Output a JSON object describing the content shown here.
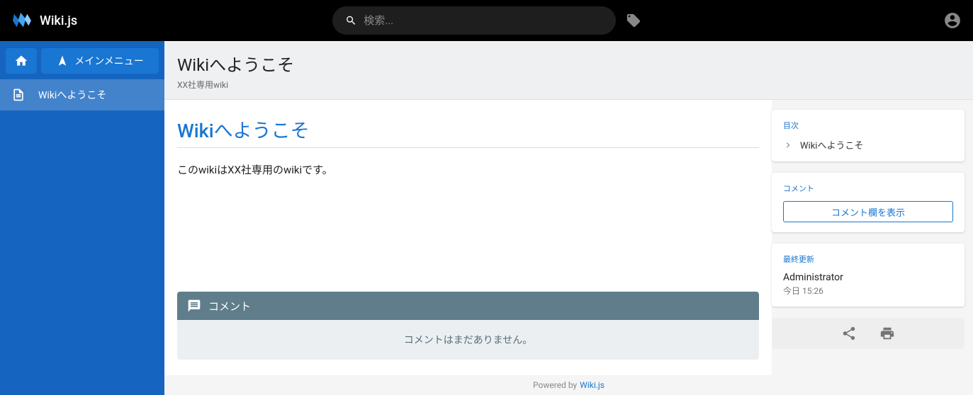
{
  "header": {
    "app_name": "Wiki.js",
    "search_placeholder": "検索..."
  },
  "sidebar": {
    "main_menu_label": "メインメニュー",
    "items": [
      {
        "label": "Wikiへようこそ"
      }
    ]
  },
  "page": {
    "title": "Wikiへようこそ",
    "subtitle": "XX社専用wiki",
    "heading": "Wikiへようこそ",
    "body": "このwikiはXX社専用のwikiです。"
  },
  "comments": {
    "section_label": "コメント",
    "empty_text": "コメントはまだありません。"
  },
  "rail": {
    "toc_label": "目次",
    "toc_item": "Wikiへようこそ",
    "comments_label": "コメント",
    "show_comments_btn": "コメント欄を表示",
    "last_updated_label": "最終更新",
    "editor_name": "Administrator",
    "updated_at": "今日 15:26"
  },
  "footer": {
    "powered_by": "Powered by",
    "link_text": "Wiki.js"
  }
}
